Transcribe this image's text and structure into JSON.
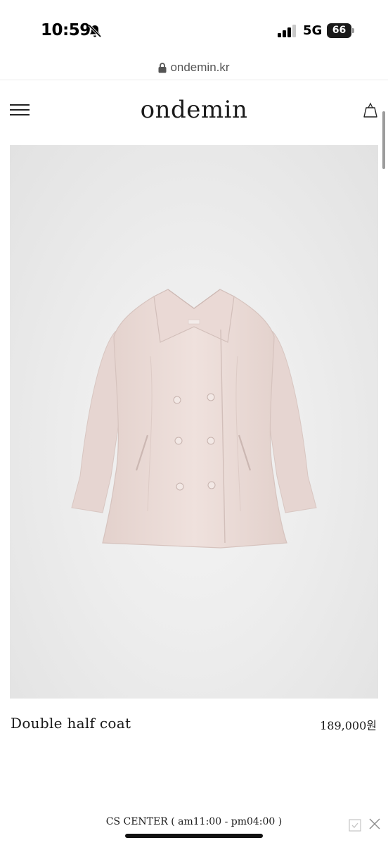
{
  "status_bar": {
    "time": "10:59",
    "network": "5G",
    "battery": "66",
    "icons": [
      "bell-slash-icon",
      "signal-icon",
      "battery-icon"
    ]
  },
  "browser": {
    "url": "ondemin.kr"
  },
  "header": {
    "logo": "ondemin",
    "icons": [
      "menu-icon",
      "shopping-bag-icon"
    ]
  },
  "product": {
    "name": "Double half coat",
    "price": "189,000원",
    "image_subject": "double-breasted pink coat"
  },
  "footer": {
    "cs_center": "CS CENTER ( am11:00 - pm04:00 )",
    "icons": [
      "check-icon",
      "close-icon"
    ]
  },
  "colors": {
    "coat": "#ecdcd8",
    "image_background": "#ececec",
    "text": "#1a1a1a"
  }
}
